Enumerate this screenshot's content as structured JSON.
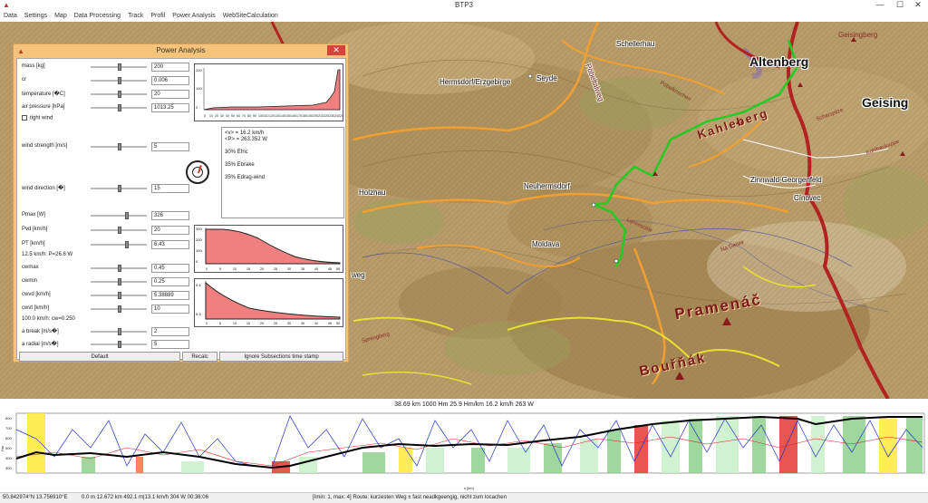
{
  "window": {
    "title": "BTP3",
    "minimize": "—",
    "maximize": "☐",
    "close": "✕"
  },
  "menu": [
    "Data",
    "Settings",
    "Map",
    "Data Processing",
    "Track",
    "Profil",
    "Power Analysis",
    "WebSiteCalculation"
  ],
  "map": {
    "labels": {
      "altenberg": "Altenberg",
      "geising": "Geising",
      "geisingberg": "Geisingberg",
      "schellerhau": "Schellerhau",
      "hermsdorf": "Hermsdorf/Erzgebirge",
      "seyde": "Seyde",
      "pobeltalweg": "Pöbeltalweg",
      "kahleberg": "Kahleberg",
      "neuhermsdorf": "Neuhermsdorf",
      "zinnwald": "Zinnwald-Georgenfeld",
      "cinovec": "Cínovec",
      "holzhau": "Holzhau",
      "moldava": "Moldava",
      "pramenac": "Pramenáč",
      "bournak": "Bouřňák",
      "weg": "weg",
      "pobelknochen": "Pöbelknochen",
      "scharspitze": "Scharspitze",
      "kohlhaukuppe": "Kohlhaukuppe",
      "lammschle": "Lammschle",
      "nageiste": "Na Geiste",
      "sprengberg": "Sprengberg"
    }
  },
  "power": {
    "title": "Power Analysis",
    "close": "✕",
    "fields": [
      {
        "label": "mass [kg]",
        "value": "200"
      },
      {
        "label": "cr",
        "value": "0.006"
      },
      {
        "label": "temperature [�C]",
        "value": "20"
      },
      {
        "label": "air pressure [hPa]",
        "value": "1013.25"
      }
    ],
    "tight_wind": "tight wind",
    "wind_strength": {
      "label": "wind strength [m/s]",
      "value": "5"
    },
    "wind_direction": {
      "label": "wind direction [�]",
      "value": "15"
    },
    "pfields": [
      {
        "label": "Pmax [W]",
        "value": "326"
      },
      {
        "label": "Pvd [km/h]",
        "value": "20"
      },
      {
        "label": "PT [km/h]",
        "value": "6.43"
      }
    ],
    "pt_note": "12.5 km/h: P=26.6 W",
    "cwfields": [
      {
        "label": "cwmax",
        "value": "0.45"
      },
      {
        "label": "cwmin",
        "value": "0.25"
      },
      {
        "label": "cwvd [km/h]",
        "value": "5.38889"
      },
      {
        "label": "cwvt [km/h]",
        "value": "10"
      }
    ],
    "cw_note": "100.0 km/h: cw=0.250",
    "afields": [
      {
        "label": "a break [m/s�]",
        "value": "2"
      },
      {
        "label": "a radial [m/s�]",
        "value": "5"
      }
    ],
    "info": {
      "v": "<v> = 16.2 km/h",
      "p": "<P> = 263.352 W",
      "line1": "30% Efric",
      "line2": "35% Ebrake",
      "line3": "35% Edrag-wind"
    },
    "buttons": {
      "default": "Default",
      "recalc": "Recalc",
      "ignore": "Ignore Subsections time stamp"
    },
    "top_chart": {
      "yticks": [
        "200",
        "100",
        "0"
      ],
      "xticks": [
        "0",
        "10",
        "20",
        "30",
        "40",
        "50",
        "60",
        "70",
        "80",
        "90",
        "100",
        "110",
        "120",
        "130",
        "140",
        "150",
        "160",
        "170",
        "180",
        "190",
        "200",
        "210",
        "220",
        "230",
        "240",
        "250"
      ]
    },
    "mid_chart": {
      "yticks": [
        "300",
        "200",
        "100",
        "0"
      ],
      "xticks": [
        "0",
        "5",
        "10",
        "15",
        "20",
        "25",
        "30",
        "35",
        "40",
        "45",
        "50"
      ]
    },
    "bot_chart": {
      "yticks": [
        "0.4",
        "0.3"
      ],
      "xticks": [
        "0",
        "5",
        "10",
        "15",
        "20",
        "25",
        "30",
        "35",
        "40",
        "45",
        "50"
      ]
    }
  },
  "stats": "38.69 km   1000 Hm   25.9 Hm/km   16.2 km/h   263 W",
  "profile": {
    "yticks": [
      "800",
      "700",
      "600",
      "500",
      "400",
      "300",
      "200"
    ],
    "ylabel": "Hm",
    "xlabel": "s [km]"
  },
  "status": {
    "coords": "50.842974°N  13.756910°E",
    "values": "0.0 m  12.672 km  492.1 m|13.1 km/h  304 W  00:36:06",
    "hint": "[Imin: 1, max: 4] Route: kurzesten Weg ± fast neadkgeengig, nicht zum locachen"
  },
  "colors": {
    "dialog": "#f5c47a",
    "close": "#d9423a",
    "route": "#22cc22",
    "road_main": "#b22222",
    "road_orange": "#f0a030",
    "road_yellow": "#e8e030"
  }
}
